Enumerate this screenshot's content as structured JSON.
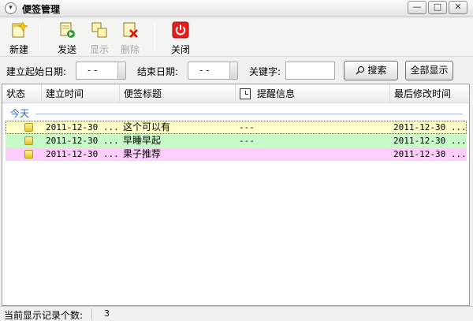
{
  "window": {
    "title": "便签管理",
    "min": "—",
    "max": "□",
    "close": "✕"
  },
  "toolbar": {
    "new": "新建",
    "send": "发送",
    "show": "显示",
    "delete": "删除",
    "close": "关闭"
  },
  "filter": {
    "start_label": "建立起始日期:",
    "start_value": "- -",
    "end_label": "结束日期:",
    "end_value": "- -",
    "keyword_label": "关键字:",
    "keyword_value": "",
    "search_btn": "搜索",
    "show_all_btn": "全部显示"
  },
  "grid": {
    "columns": [
      "状态",
      "建立时间",
      "便签标题",
      "提醒信息",
      "最后修改时间"
    ],
    "group_label": "今天",
    "rows": [
      {
        "created": "2011-12-30 ...",
        "title": "这个可以有",
        "reminder": "---",
        "modified": "2011-12-30 ...",
        "color": "#ffffc8"
      },
      {
        "created": "2011-12-30 ...",
        "title": "早睡早起",
        "reminder": "---",
        "modified": "2011-12-30 ...",
        "color": "#c9fbc9"
      },
      {
        "created": "2011-12-30 ...",
        "title": "果子推荐",
        "reminder": "",
        "modified": "2011-12-30 ...",
        "color": "#ffcdfb"
      }
    ]
  },
  "status": {
    "label": "当前显示记录个数:",
    "count": "3"
  }
}
